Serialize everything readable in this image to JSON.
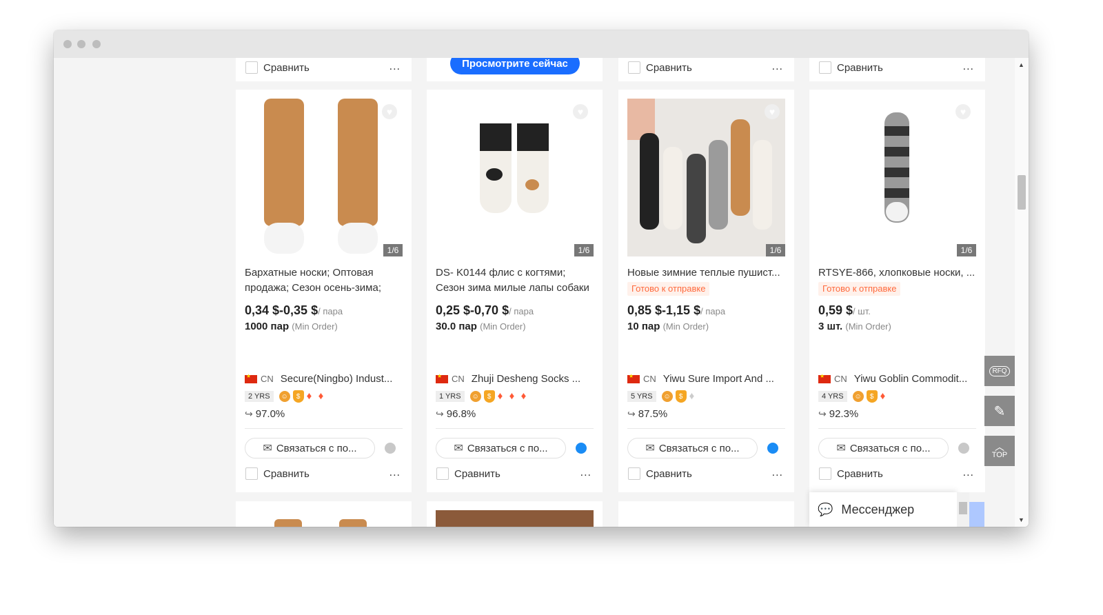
{
  "compare_label": "Сравнить",
  "more_label": "...",
  "cta_label": "Просмотрите сейчас",
  "contact_label": "Связаться с по...",
  "min_order_label": "(Min Order)",
  "ready_label": "Готово к отправке",
  "messenger_label": "Мессенджер",
  "rfq_label": "RFQ",
  "top_label": "TOP",
  "products": [
    {
      "title_lines": [
        "Бархатные носки; Оптовая",
        "продажа; Сезон осень-зима;"
      ],
      "ready": false,
      "price": "0,34 $-0,35 $",
      "unit": "/ пара",
      "moq": "1000 пар",
      "image_counter": "1/6",
      "country": "CN",
      "supplier": "Secure(Ningbo) Indust...",
      "years": "2 YRS",
      "diamonds": 2,
      "grey_diamonds": 0,
      "rate": "97.0%",
      "chat_online": false
    },
    {
      "title_lines": [
        "DS- K0144 флис с когтями;",
        "Сезон зима милые лапы собаки"
      ],
      "ready": false,
      "price": "0,25 $-0,70 $",
      "unit": "/ пара",
      "moq": "30.0 пар",
      "image_counter": "1/6",
      "country": "CN",
      "supplier": "Zhuji Desheng Socks ...",
      "years": "1 YRS",
      "diamonds": 3,
      "grey_diamonds": 0,
      "rate": "96.8%",
      "chat_online": true
    },
    {
      "title_lines": [
        "Новые зимние теплые пушист..."
      ],
      "ready": true,
      "price": "0,85 $-1,15 $",
      "unit": "/ пара",
      "moq": "10 пар",
      "image_counter": "1/6",
      "country": "CN",
      "supplier": "Yiwu Sure Import And ...",
      "years": "5 YRS",
      "diamonds": 0,
      "grey_diamonds": 1,
      "rate": "87.5%",
      "chat_online": true
    },
    {
      "title_lines": [
        "RTSYE-866, хлопковые носки, ..."
      ],
      "ready": true,
      "price": "0,59 $",
      "unit": "/ шт.",
      "moq": "3 шт.",
      "image_counter": "1/6",
      "country": "CN",
      "supplier": "Yiwu Goblin Commodit...",
      "years": "4 YRS",
      "diamonds": 1,
      "grey_diamonds": 0,
      "rate": "92.3%",
      "chat_online": false
    }
  ],
  "colors": {
    "accent_blue": "#1a6dff",
    "price_text": "#222222",
    "ready_text": "#ff6a3d",
    "diamond": "#ff5a36"
  }
}
